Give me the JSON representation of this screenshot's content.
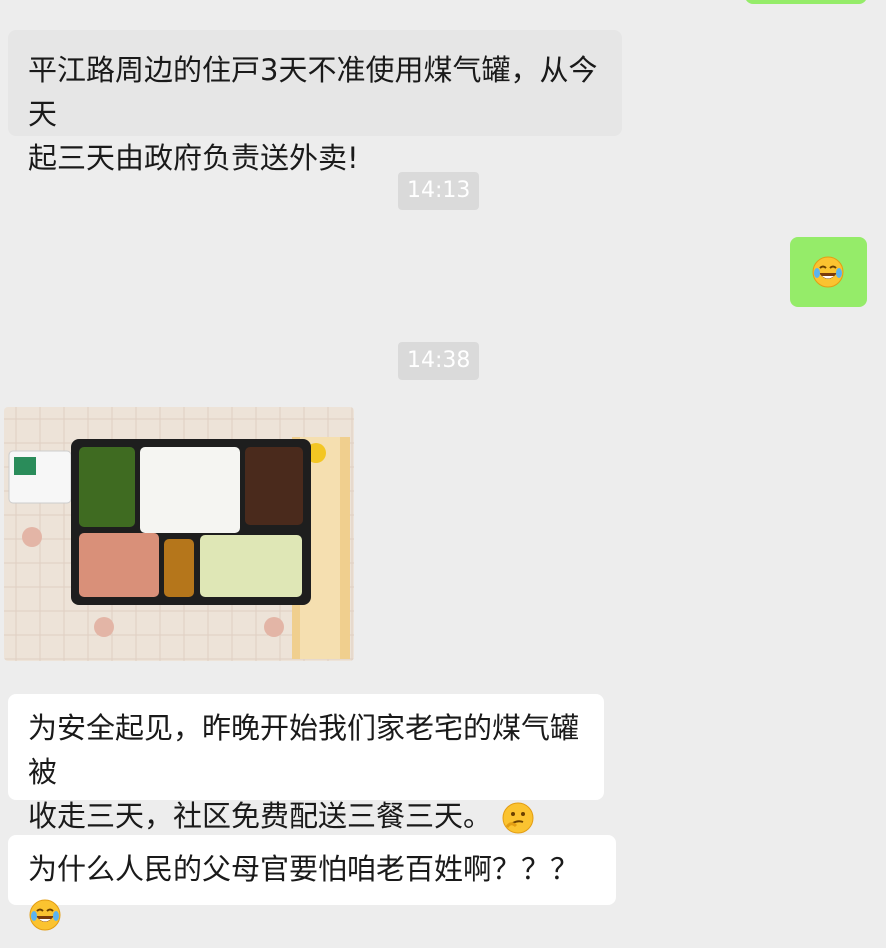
{
  "messages": {
    "m1": "平江路周边的住戸3天不准使用煤气罐，从今天起三天由政府负责送外卖!",
    "m1_line1": "平江路周边的住戸3天不准使用煤气罐，从今天",
    "m1_line2": "起三天由政府负责送外卖!",
    "ts1": "14:13",
    "reply_emoji": "laughing-crying-face-icon",
    "ts2": "14:38",
    "photo_alt": "lunch box photo",
    "m2_line1": "为安全起见，昨晚开始我们家老宅的煤气罐被",
    "m2_line2": "收走三天，社区免费配送三餐三天。",
    "m3": "为什么人民的父母官要怕咱老百姓啊？？？"
  },
  "colors": {
    "background": "#ededed",
    "incoming_bubble": "#ffffff",
    "incoming_gray_bubble": "#e6e6e6",
    "outgoing_bubble": "#95ec69",
    "timestamp_bg": "#dadada"
  }
}
